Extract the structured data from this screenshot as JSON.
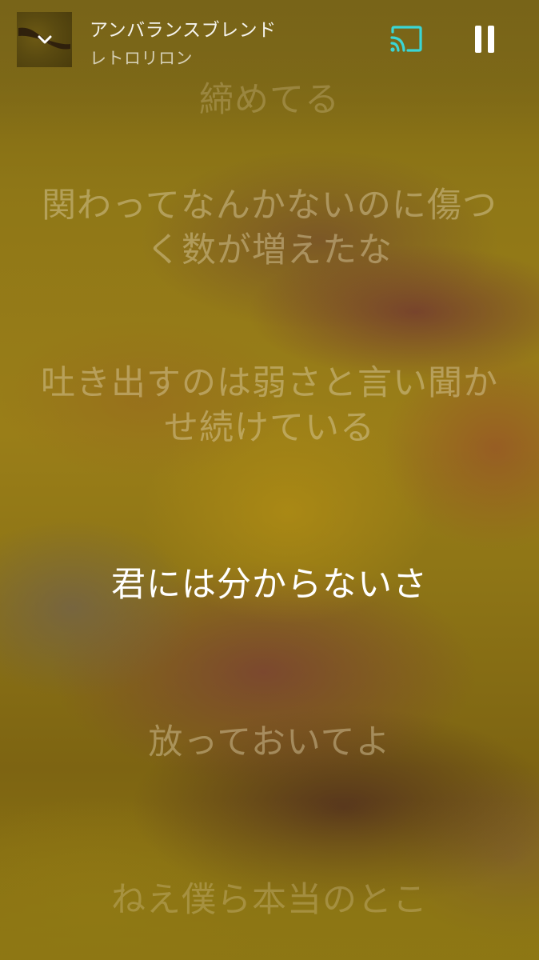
{
  "now_playing": {
    "title": "アンバランスブレンド",
    "artist": "レトロリロン"
  },
  "icons": {
    "collapse": "chevron-down-icon",
    "cast": "cast-icon",
    "pause": "pause-icon"
  },
  "colors": {
    "cast_active": "#3ad6d6",
    "lyric_current": "#ffffff",
    "background_primary": "#8f7717"
  },
  "lyrics": {
    "line_previous_partial": "締めてる",
    "line_1": "関わってなんかないのに傷つく数が増えたな",
    "line_2": "吐き出すのは弱さと言い聞かせ続けている",
    "line_current": "君には分からないさ",
    "line_4": "放っておいてよ",
    "line_5": "ねえ僕ら本当のとこ"
  }
}
